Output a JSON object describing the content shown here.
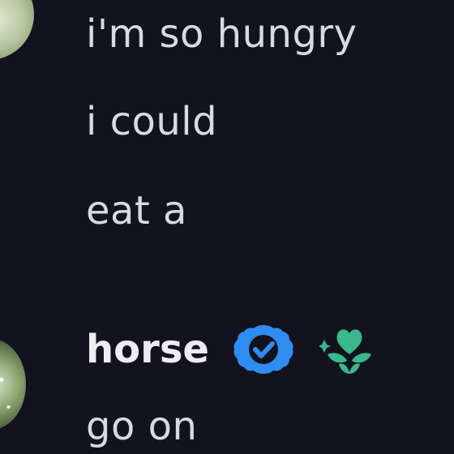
{
  "messages": [
    {
      "text": "i'm so hungry"
    },
    {
      "text": "i could"
    },
    {
      "text": "eat a"
    },
    {
      "author": "horse",
      "badges": [
        "verified-badge-icon",
        "green-heart-bloom-icon"
      ]
    },
    {
      "text": "go on"
    }
  ],
  "colors": {
    "background": "#12131f",
    "text": "#d9d9e0",
    "username": "#ececf2",
    "verified_blue": "#2f8cf0",
    "badge_green": "#3ab78c"
  }
}
